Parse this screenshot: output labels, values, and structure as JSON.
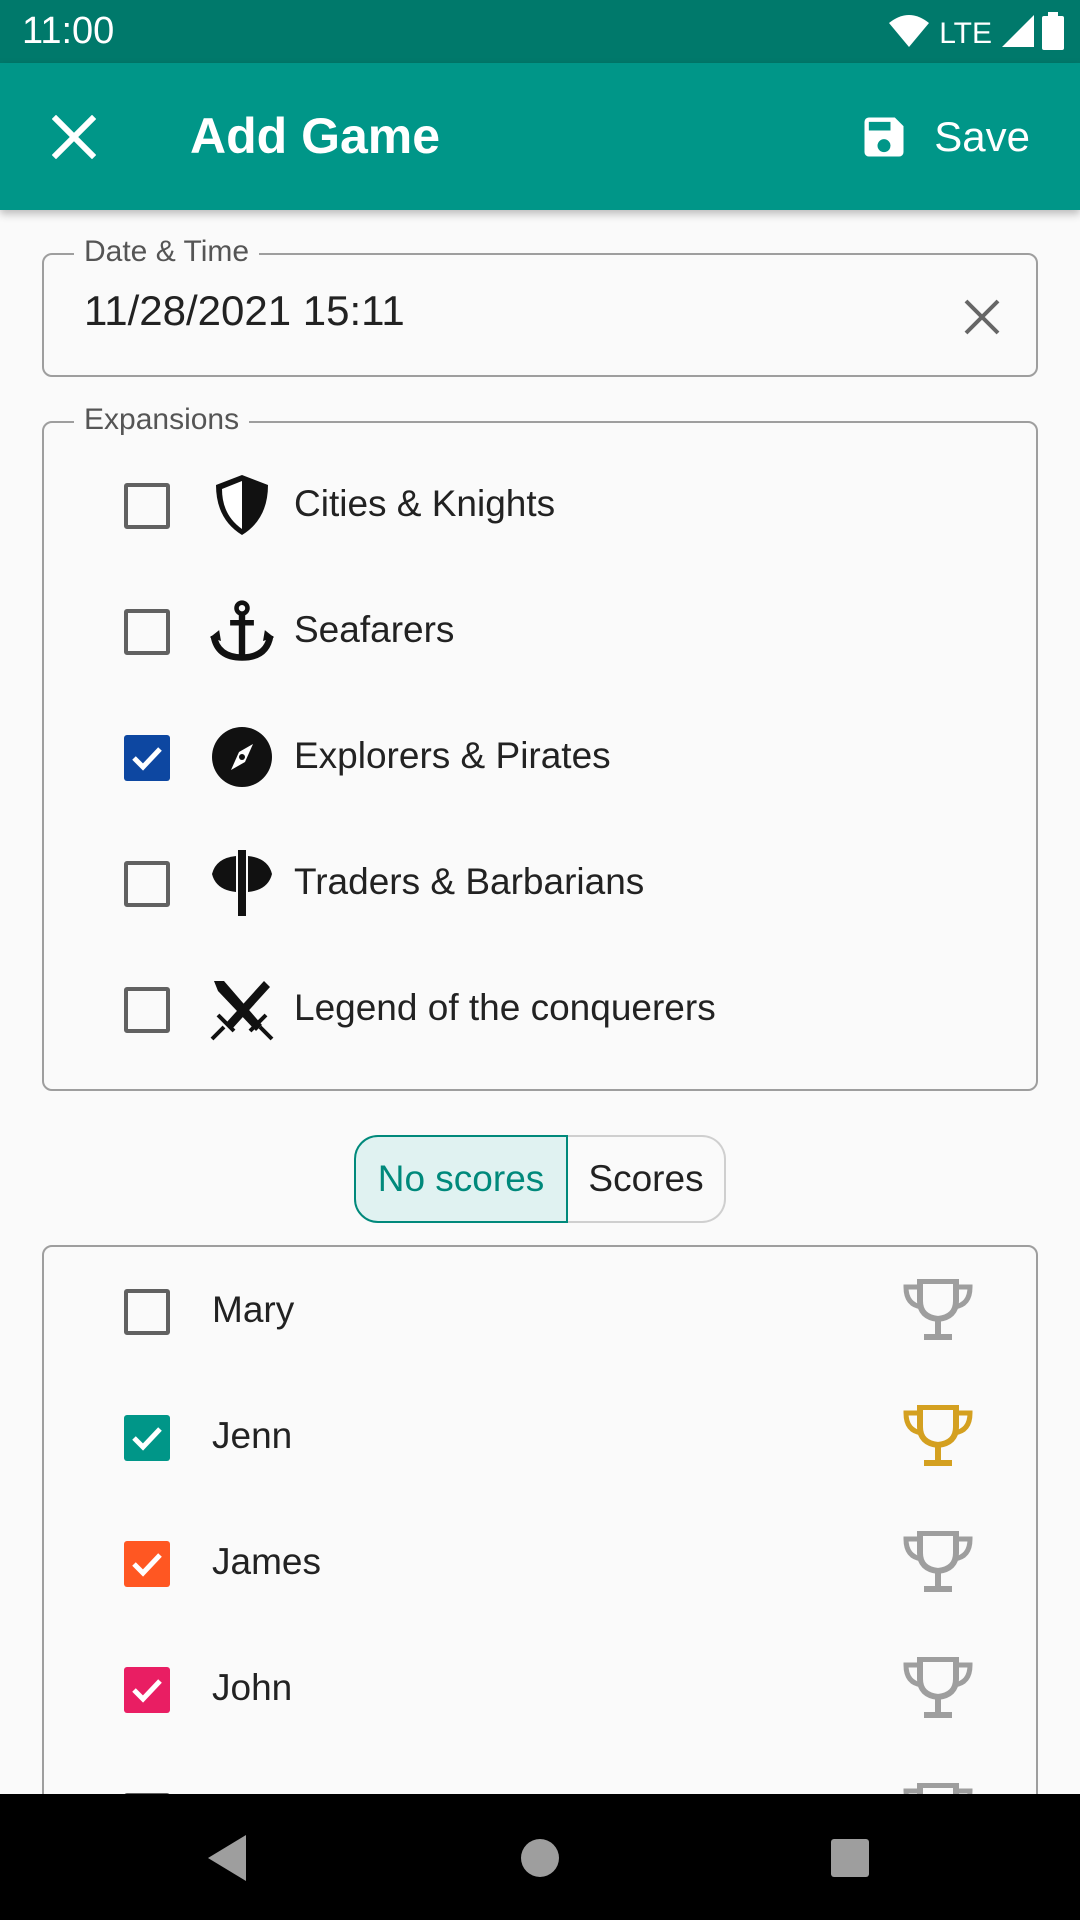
{
  "status_bar": {
    "time": "11:00",
    "network": "LTE",
    "icons": [
      "wifi-icon",
      "signal-icon",
      "battery-icon"
    ]
  },
  "app_bar": {
    "title": "Add Game",
    "save_label": "Save",
    "close_icon": "close-icon",
    "save_icon": "save-icon"
  },
  "date_field": {
    "legend": "Date & Time",
    "value": "11/28/2021 15:11"
  },
  "expansions": {
    "legend": "Expansions",
    "items": [
      {
        "label": "Cities & Knights",
        "checked": false,
        "icon": "shield-icon"
      },
      {
        "label": "Seafarers",
        "checked": false,
        "icon": "anchor-icon"
      },
      {
        "label": "Explorers & Pirates",
        "checked": true,
        "icon": "compass-icon"
      },
      {
        "label": "Traders & Barbarians",
        "checked": false,
        "icon": "battle-axe-icon"
      },
      {
        "label": "Legend of the conquerers",
        "checked": false,
        "icon": "crossed-swords-icon"
      }
    ]
  },
  "score_toggle": {
    "options": [
      "No scores",
      "Scores"
    ],
    "selected": "No scores"
  },
  "players": [
    {
      "name": "Mary",
      "checked": false,
      "color": "#616161",
      "winner": false
    },
    {
      "name": "Jenn",
      "checked": true,
      "color": "#009688",
      "winner": true
    },
    {
      "name": "James",
      "checked": true,
      "color": "#ff5722",
      "winner": false
    },
    {
      "name": "John",
      "checked": true,
      "color": "#e91e63",
      "winner": false
    }
  ],
  "colors": {
    "primary": "#009688",
    "primary_dark": "#00796b",
    "expansion_check": "#0d47a1",
    "trophy_gold": "#d4a020",
    "trophy_grey": "#9e9e9e"
  }
}
